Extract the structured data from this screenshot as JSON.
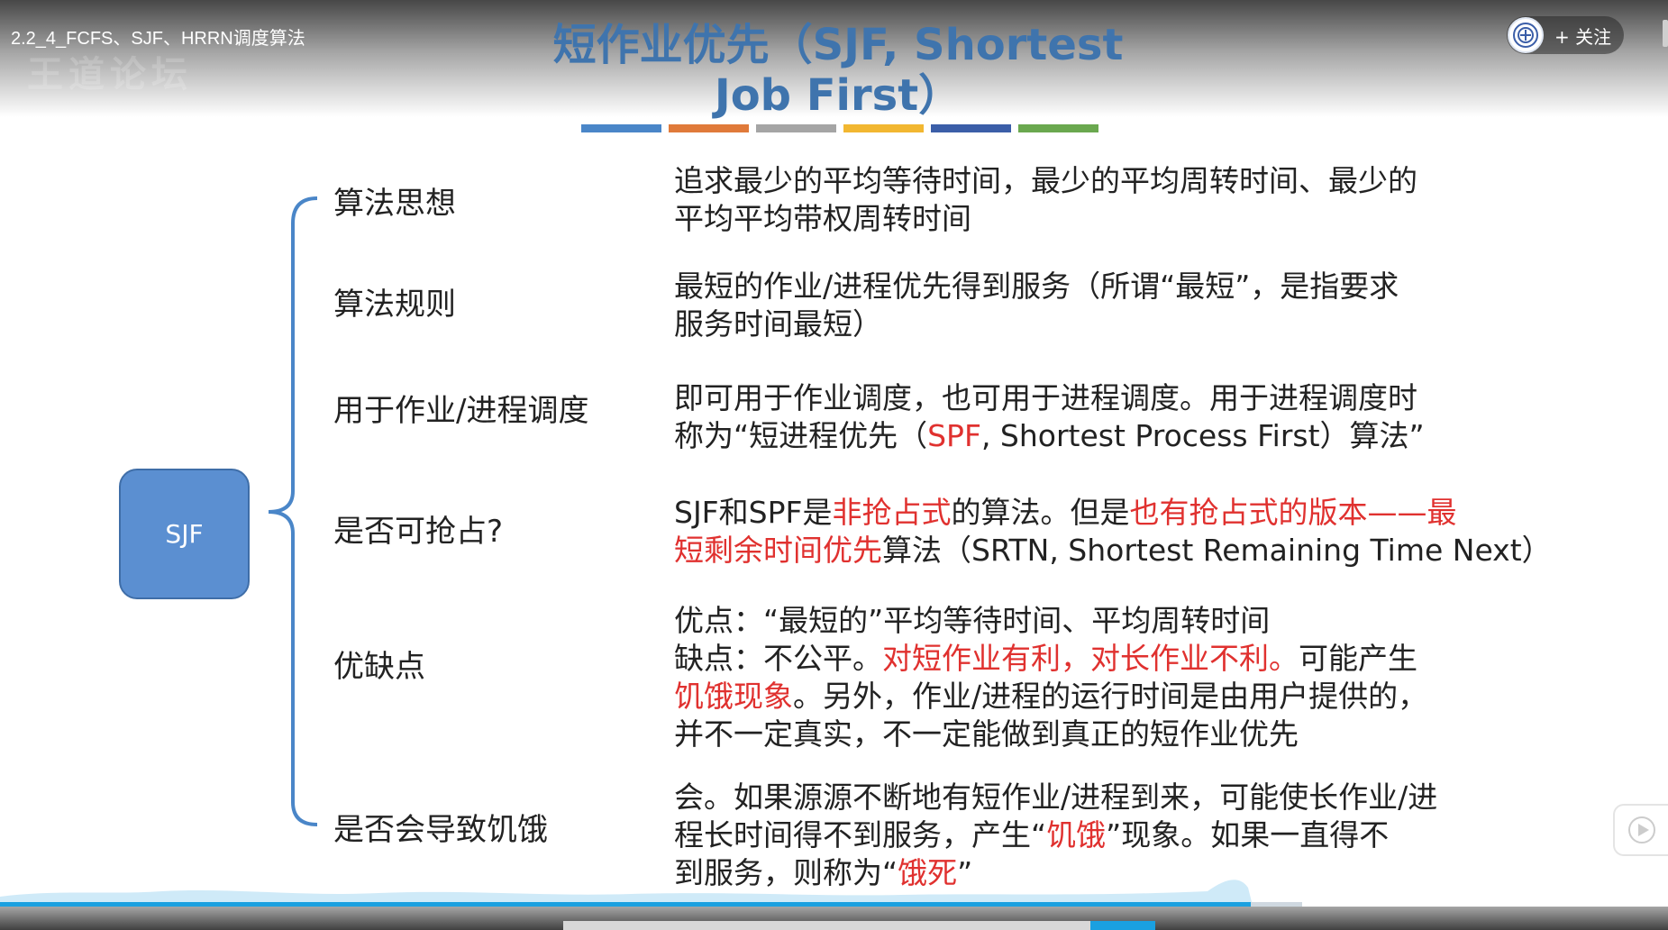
{
  "video": {
    "title": "2.2_4_FCFS、SJF、HRRN调度算法",
    "watermark": "王道论坛",
    "follow_label": "+ 关注"
  },
  "slide": {
    "title_line1": "短作业优先（SJF, Shortest",
    "title_line2": "Job First）",
    "accent_bars": [
      "#4a86c8",
      "#e07a3a",
      "#a5a5a5",
      "#f2b731",
      "#3b5ea8",
      "#6aa84f"
    ],
    "root_label": "SJF",
    "rows": [
      {
        "label": "算法思想",
        "lines": [
          [
            {
              "t": "追求最少的平均等待时间，最少的平均周转时间、最少的"
            }
          ],
          [
            {
              "t": "平均平均带权周转时间"
            }
          ]
        ]
      },
      {
        "label": "算法规则",
        "lines": [
          [
            {
              "t": "最短的作业/进程优先得到服务（所谓“最短”，是指要求"
            }
          ],
          [
            {
              "t": "服务时间最短）"
            }
          ]
        ]
      },
      {
        "label": "用于作业/进程调度",
        "lines": [
          [
            {
              "t": "即可用于作业调度，也可用于进程调度。用于进程调度时"
            }
          ],
          [
            {
              "t": "称为“短进程优先（"
            },
            {
              "t": "SPF",
              "red": true
            },
            {
              "t": ", Shortest Process First）算法”"
            }
          ]
        ]
      },
      {
        "label": "是否可抢占?",
        "lines": [
          [
            {
              "t": "SJF和SPF是"
            },
            {
              "t": "非抢占式",
              "red": true
            },
            {
              "t": "的算法。但是"
            },
            {
              "t": "也有抢占式的版本——最",
              "red": true
            }
          ],
          [
            {
              "t": "短剩余时间优先",
              "red": true
            },
            {
              "t": "算法（SRTN, Shortest Remaining Time Next）"
            }
          ]
        ]
      },
      {
        "label": "优缺点",
        "lines": [
          [
            {
              "t": "优点：“最短的”平均等待时间、平均周转时间"
            }
          ],
          [
            {
              "t": "缺点：不公平。"
            },
            {
              "t": "对短作业有利，对长作业不利。",
              "red": true
            },
            {
              "t": "可能产生"
            }
          ],
          [
            {
              "t": "饥饿现象",
              "red": true
            },
            {
              "t": "。另外，作业/进程的运行时间是由用户提供的，"
            }
          ],
          [
            {
              "t": "并不一定真实，不一定能做到真正的短作业优先"
            }
          ]
        ]
      },
      {
        "label": "是否会导致饥饿",
        "lines": [
          [
            {
              "t": "会。如果源源不断地有短作业/进程到来，可能使长作业/进"
            }
          ],
          [
            {
              "t": "程长时间得不到服务，产生“"
            },
            {
              "t": "饥饿",
              "red": true
            },
            {
              "t": "”现象。如果一直得不"
            }
          ],
          [
            {
              "t": "到服务，则称为“"
            },
            {
              "t": "饿死",
              "red": true
            },
            {
              "t": "”"
            }
          ]
        ]
      }
    ]
  },
  "player": {
    "progress": 0.75,
    "icons": [
      "uploader-avatar-icon",
      "play-icon"
    ]
  }
}
